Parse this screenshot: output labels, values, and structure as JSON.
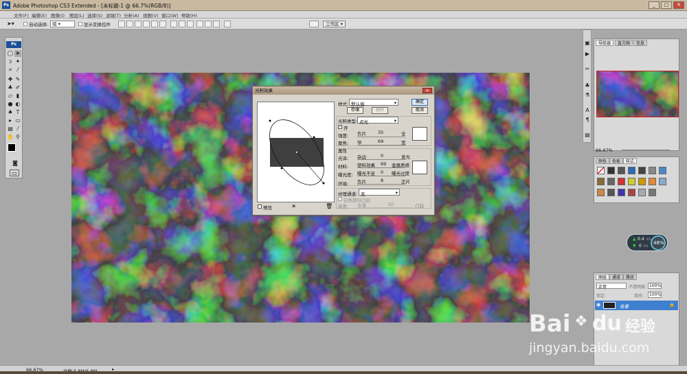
{
  "window": {
    "title": "Adobe Photoshop CS3 Extended - [未标题-1 @ 66.7%(RGB/8)]"
  },
  "menu": [
    "文件(F)",
    "编辑(E)",
    "图像(I)",
    "图层(L)",
    "选择(S)",
    "滤镜(T)",
    "分析(A)",
    "视图(V)",
    "窗口(W)",
    "帮助(H)"
  ],
  "options": {
    "auto_select_label": "自动选择:",
    "auto_select_value": "组",
    "show_transform": "显示变换控件",
    "workspace": "工作区 ▾"
  },
  "dialog": {
    "title": "光照效果",
    "style_label": "样式:",
    "style_value": "默认值",
    "ok": "确定",
    "cancel": "取消",
    "save": "存储",
    "delete": "删除",
    "light_type_label": "光照类型:",
    "light_type_value": "点光",
    "on_label": "开",
    "intensity_label": "强度:",
    "intensity_min": "负片",
    "intensity_value": "35",
    "intensity_max": "全",
    "focus_label": "聚焦:",
    "focus_min": "窄",
    "focus_value": "69",
    "focus_max": "宽",
    "properties_label": "属性",
    "gloss_label": "光泽:",
    "gloss_min": "杂边",
    "gloss_value": "0",
    "gloss_max": "发光",
    "material_label": "材料:",
    "material_min": "塑料效果",
    "material_value": "69",
    "material_max": "金属质感",
    "exposure_label": "曝光度:",
    "exposure_min": "曝光不足",
    "exposure_value": "0",
    "exposure_max": "曝光过度",
    "ambience_label": "环境:",
    "ambience_min": "负片",
    "ambience_value": "8",
    "ambience_max": "正片",
    "texture_label": "纹理通道:",
    "texture_value": "无",
    "white_high": "白色部分凸出",
    "height_label": "高度:",
    "height_min": "平滑",
    "height_value": "50",
    "height_max": "凸起",
    "preview_label": "预览"
  },
  "panels": {
    "nav_tabs": [
      "导航器",
      "直方图",
      "信息"
    ],
    "nav_zoom": "66.67%",
    "style_tabs": [
      "颜色",
      "色板",
      "样式"
    ],
    "layer_tabs": [
      "图层",
      "通道",
      "路径"
    ],
    "blend_mode": "正常",
    "opacity_label": "不透明度:",
    "opacity_value": "100%",
    "lock_label": "锁定:",
    "fill_label": "填充:",
    "fill_value": "100%",
    "layer_name": "背景"
  },
  "widget": {
    "up": "0.4",
    "down": "0",
    "unit": "K/S",
    "percent": "48%"
  },
  "status": {
    "zoom": "66.67%",
    "doc": "文档:5.8M/5.8M"
  },
  "watermark": {
    "brand": "Bai",
    "brand2": "du",
    "cn": "经验",
    "url": "jingyan.baidu.com"
  }
}
